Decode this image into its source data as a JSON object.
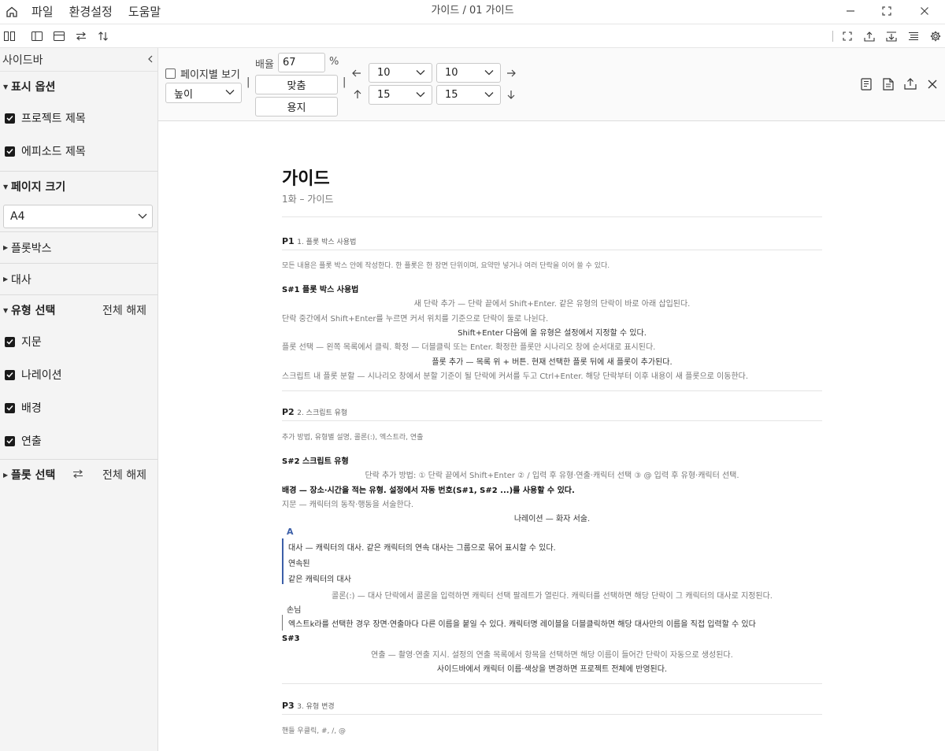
{
  "titlebar": {
    "menus": [
      "파일",
      "환경설정",
      "도움말"
    ],
    "title": "가이드 / 01 가이드"
  },
  "sidebar": {
    "title": "사이드바",
    "display_options": {
      "label": "표시 옵션",
      "items": [
        "프로젝트 제목",
        "에피소드 제목"
      ]
    },
    "page_size": {
      "label": "페이지 크기",
      "value": "A4"
    },
    "plotbox": {
      "label": "플롯박스"
    },
    "dialogue": {
      "label": "대사"
    },
    "type_select": {
      "label": "유형 선택",
      "clear": "전체 해제",
      "items": [
        "지문",
        "나레이션",
        "배경",
        "연출"
      ]
    },
    "plot_select": {
      "label": "플롯 선택",
      "clear": "전체 해제"
    }
  },
  "options": {
    "page_view": "페이지별 보기",
    "height_select": "높이",
    "zoom_label": "배율",
    "zoom_value": "67",
    "zoom_unit": "%",
    "fit_button": "맞춤",
    "paper_button": "용지",
    "sep": "|",
    "margin_left": "10",
    "margin_right": "10",
    "margin_top": "15",
    "margin_bottom": "15"
  },
  "document": {
    "title": "가이드",
    "subtitle": "1화 – 가이드",
    "p1": {
      "num": "P1",
      "title": "1. 플롯 박스 사용법",
      "summary": "모든 내용은 플롯 박스 안에 작성한다. 한 플롯은 한 장면 단위이며, 요약만 넣거나 여러 단락을 이어 쓸 수 있다.",
      "scene": "S#1 플롯 박스 사용법",
      "lines": [
        "새 단락 추가 — 단락 끝에서 Shift+Enter. 같은 유형의 단락이 바로 아래 삽입된다.",
        "단락 중간에서 Shift+Enter를 누르면 커서 위치를 기준으로 단락이 둘로 나뉜다.",
        "Shift+Enter 다음에 올 유형은 설정에서 지정할 수 있다.",
        "플롯 선택 — 왼쪽 목록에서 클릭. 확정 — 더블클릭 또는 Enter. 확정한 플롯만 시나리오 창에 순서대로 표시된다.",
        "플롯 추가 — 목록 위 + 버튼. 현재 선택한 플롯 뒤에 새 플롯이 추가된다.",
        "스크립트 내 플롯 분할 — 시나리오 창에서 분할 기준이 될 단락에 커서를 두고 Ctrl+Enter. 해당 단락부터 이후 내용이 새 플롯으로 이동한다."
      ]
    },
    "p2": {
      "num": "P2",
      "title": "2. 스크립트 유형",
      "summary": "추가 방법, 유형별 설명, 콜론(:), 엑스트라, 연출",
      "scene": "S#2 스크립트 유형",
      "add_method": "단락 추가 방법: ① 단락 끝에서 Shift+Enter ② / 입력 후 유형·연출·캐릭터 선택 ③ @ 입력 후 유형·캐릭터 선택.",
      "background": "배경 — 장소·시간을 적는 유형. 설정에서 자동 번호(S#1, S#2 ...)를 사용할 수 있다.",
      "action": "지문 — 캐릭터의 동작·행동을 서술한다.",
      "narration": "나레이션 — 화자 서술.",
      "char_a": "A",
      "dialogue_1": "대사 — 캐릭터의 대사. 같은 캐릭터의 연속 대사는 그룹으로 묶어 표시할 수 있다.",
      "dialogue_2": "연속된",
      "dialogue_3": "같은 캐릭터의 대사",
      "colon": "콜론(:) — 대사 단락에서 콜론을 입력하면 캐릭터 선택 팔레트가 열린다. 캐릭터를 선택하면 해당 단락이 그 캐릭터의 대사로 지정된다.",
      "char_guest": "손님",
      "extra": "엑스트k라를 선택한 경우 장면·연출마다 다른 이름을 붙일 수 있다. 캐릭터명 레이블을 더블클릭하면 해당 대사만의 이름을 직접 입력할 수 있다",
      "scene3": "S#3",
      "direction": "연출 — 촬영·연출 지시. 설정의 연출 목록에서 항목을 선택하면 해당 이름이 들어간 단락이 자동으로 생성된다.",
      "sidebar_note": "사이드바에서 캐릭터 이름·색상을 변경하면 프로젝트 전체에 반영된다."
    },
    "p3": {
      "num": "P3",
      "title": "3. 유형 변경",
      "summary": "핸들 우클릭, #, /, @"
    }
  }
}
